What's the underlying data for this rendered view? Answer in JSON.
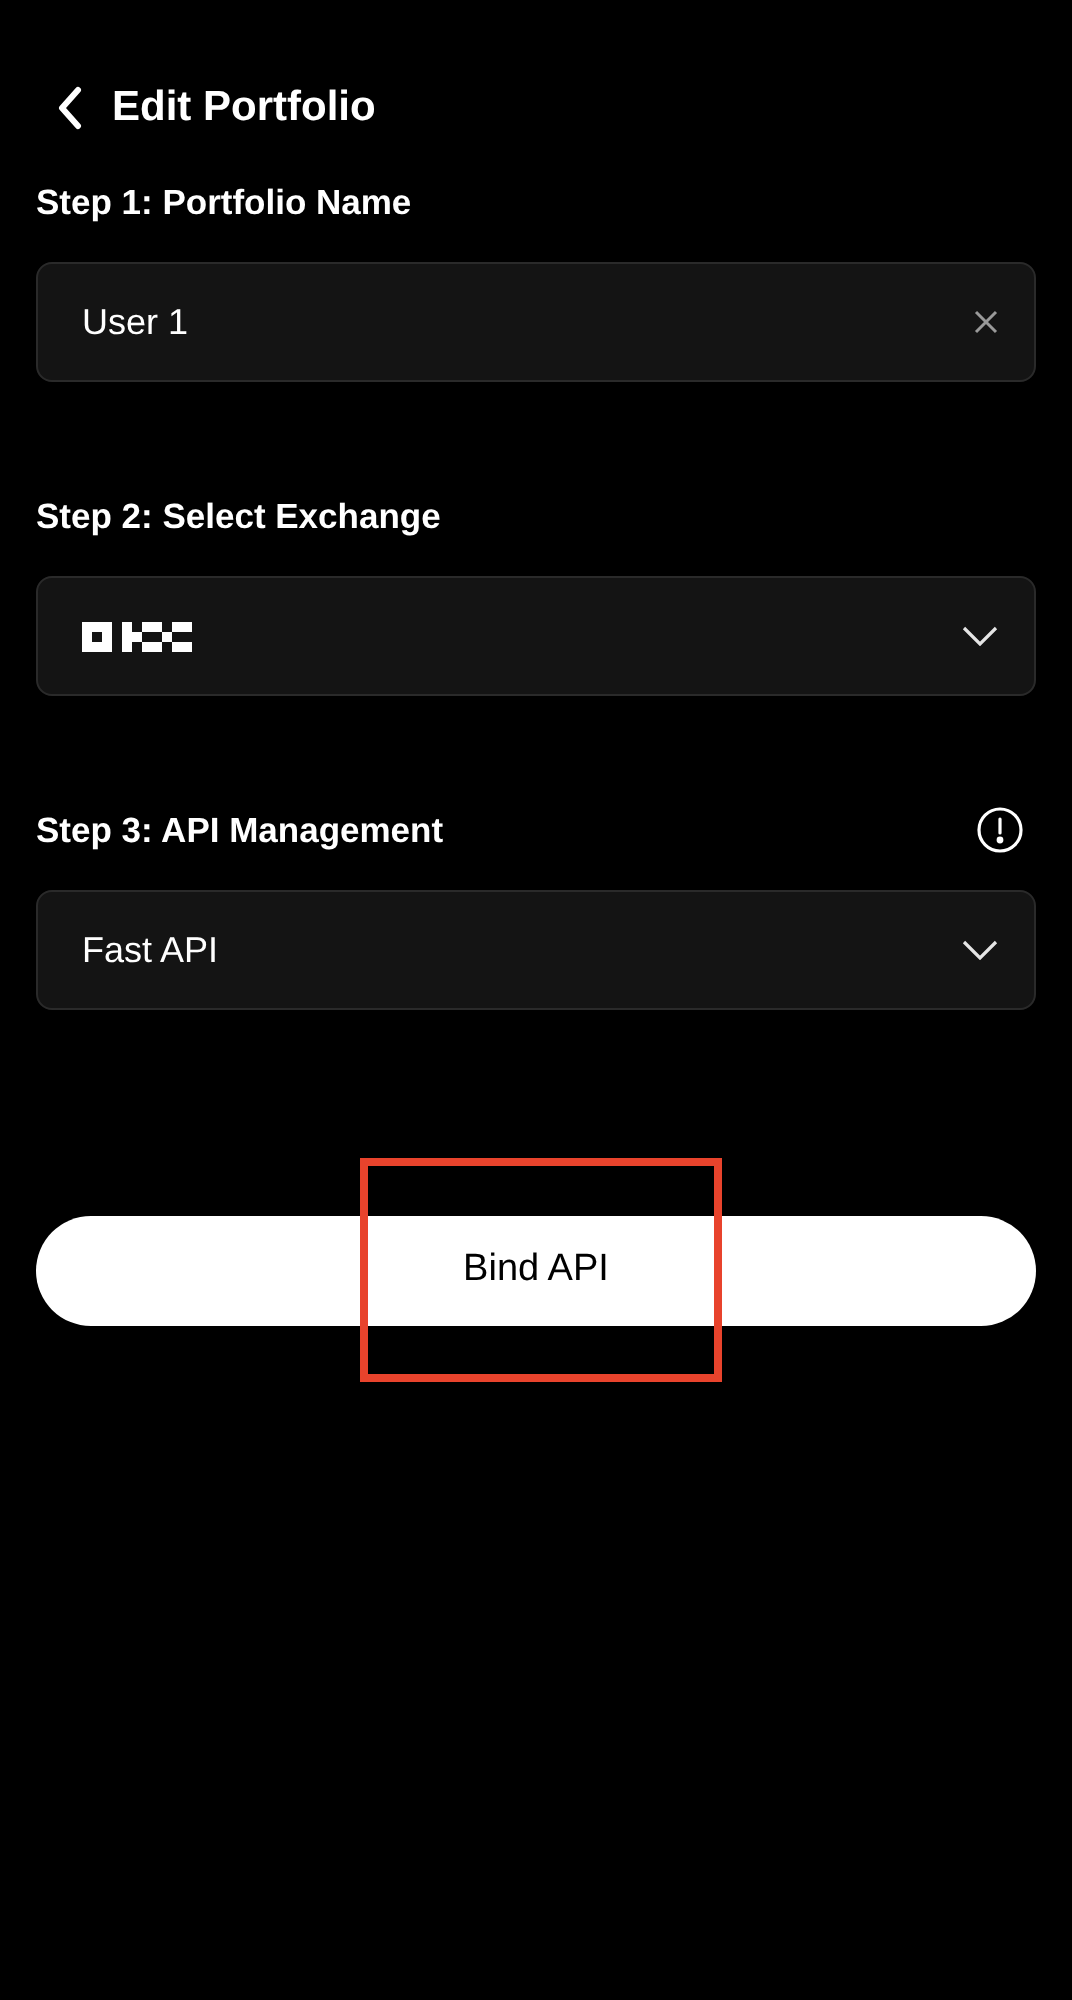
{
  "header": {
    "title": "Edit Portfolio"
  },
  "steps": [
    {
      "label": "Step 1: Portfolio Name",
      "kind": "text",
      "value": "User 1",
      "info": false
    },
    {
      "label": "Step 2: Select Exchange",
      "kind": "logo-select",
      "info": false
    },
    {
      "label": "Step 3: API Management",
      "kind": "select",
      "value": "Fast API",
      "info": true
    }
  ],
  "primary_button": {
    "label": "Bind API",
    "highlighted": true
  }
}
